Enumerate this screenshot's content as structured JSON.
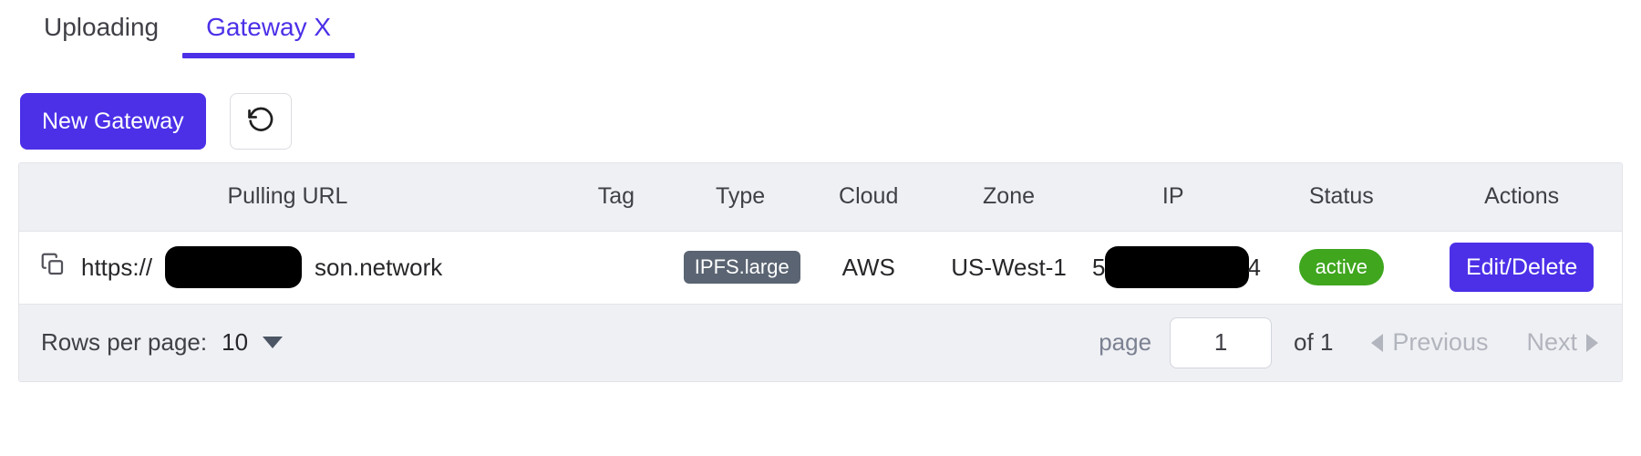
{
  "tabs": [
    {
      "label": "Uploading",
      "active": false
    },
    {
      "label": "Gateway X",
      "active": true
    }
  ],
  "toolbar": {
    "new_gateway_label": "New Gateway",
    "refresh_icon": "refresh-ccw-icon"
  },
  "table": {
    "columns": [
      "Pulling URL",
      "Tag",
      "Type",
      "Cloud",
      "Zone",
      "IP",
      "Status",
      "Actions"
    ],
    "rows": [
      {
        "copy_icon": "copy-icon",
        "url_prefix": "https://",
        "url_redacted": true,
        "url_suffix": "son.network",
        "tag": "",
        "type": "IPFS.large",
        "cloud": "AWS",
        "zone": "US-West-1",
        "ip_prefix": "5",
        "ip_redacted": true,
        "ip_suffix": "4",
        "status": "active",
        "action_label": "Edit/Delete"
      }
    ]
  },
  "footer": {
    "rows_per_page_label": "Rows per page:",
    "rows_per_page_value": "10",
    "dropdown_icon": "chevron-down-icon",
    "page_label": "page",
    "page_value": "1",
    "of_label": "of 1",
    "previous_label": "Previous",
    "next_label": "Next",
    "previous_icon": "triangle-left-icon",
    "next_icon": "triangle-right-icon"
  },
  "colors": {
    "accent": "#4b30e8",
    "status_active": "#3fa61e",
    "type_badge": "#5a6472",
    "header_bg": "#eff0f4",
    "redaction": "#000000"
  }
}
